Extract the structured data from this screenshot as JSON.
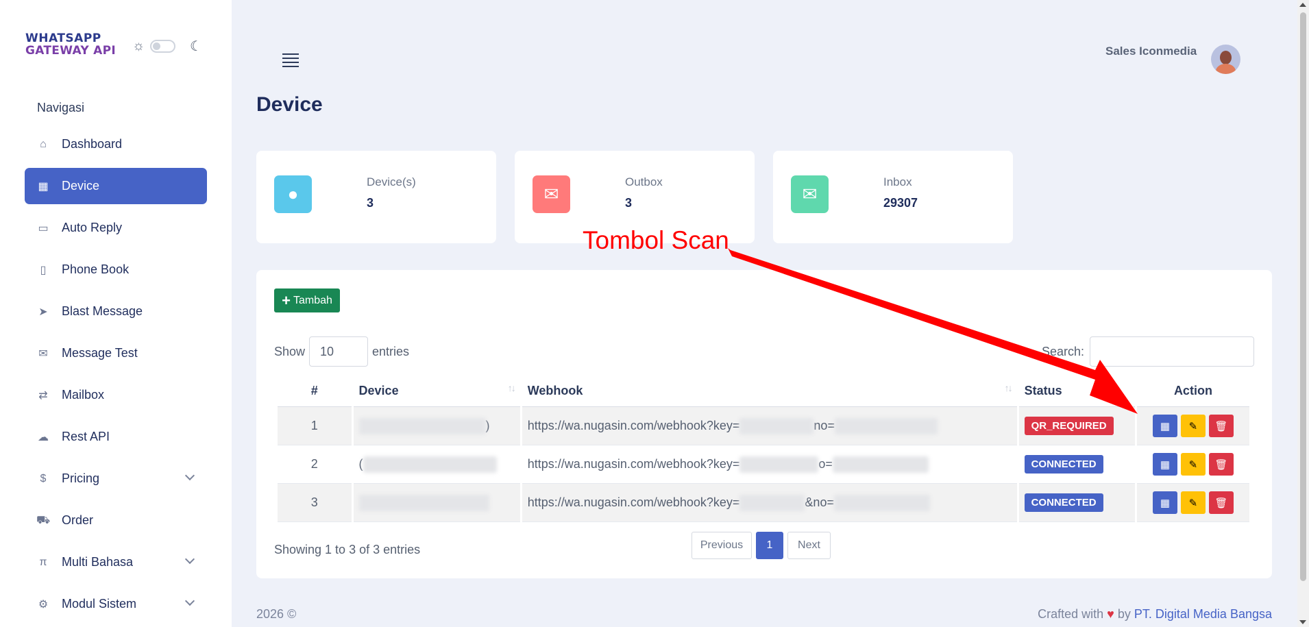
{
  "brand": {
    "line1": "WHATSAPP",
    "line2": "GATEWAY API"
  },
  "sidebar": {
    "heading": "Navigasi",
    "items": [
      {
        "label": "Dashboard",
        "icon": "home-icon",
        "active": false
      },
      {
        "label": "Device",
        "icon": "qr-icon",
        "active": true
      },
      {
        "label": "Auto Reply",
        "icon": "chat-icon",
        "active": false
      },
      {
        "label": "Phone Book",
        "icon": "book-icon",
        "active": false
      },
      {
        "label": "Blast Message",
        "icon": "send-icon",
        "active": false
      },
      {
        "label": "Message Test",
        "icon": "mail-icon",
        "active": false
      },
      {
        "label": "Mailbox",
        "icon": "swap-icon",
        "active": false
      },
      {
        "label": "Rest API",
        "icon": "cloud-icon",
        "active": false
      },
      {
        "label": "Pricing",
        "icon": "money-bag-icon",
        "active": false
      },
      {
        "label": "Order",
        "icon": "cart-icon",
        "active": false
      },
      {
        "label": "Multi Bahasa",
        "icon": "language-icon",
        "active": false
      },
      {
        "label": "Modul Sistem",
        "icon": "gear-icon",
        "active": false
      }
    ]
  },
  "header": {
    "user_name": "Sales Iconmedia"
  },
  "page": {
    "title": "Device"
  },
  "stats": [
    {
      "label": "Device(s)",
      "value": "3",
      "color": "#5ac8eb"
    },
    {
      "label": "Outbox",
      "value": "3",
      "color": "#ff7a7a"
    },
    {
      "label": "Inbox",
      "value": "29307",
      "color": "#5fd8ad"
    }
  ],
  "table_controls": {
    "add_label": "Tambah",
    "show_label": "Show",
    "entries_value": "10",
    "entries_label": "entries",
    "search_label": "Search:"
  },
  "table": {
    "headers": [
      "#",
      "Device",
      "Webhook",
      "Status",
      "Action"
    ],
    "rows": [
      {
        "num": "1",
        "device_suffix": ")",
        "webhook_a": "https://wa.nugasin.com/webhook?key=",
        "webhook_b": "no=",
        "status": "QR_REQUIRED",
        "status_color": "#dc3545"
      },
      {
        "num": "2",
        "device_suffix": "(",
        "webhook_a": "https://wa.nugasin.com/webhook?key=",
        "webhook_b": "o=",
        "status": "CONNECTED",
        "status_color": "#4663c6"
      },
      {
        "num": "3",
        "device_suffix": "",
        "webhook_a": "https://wa.nugasin.com/webhook?key=",
        "webhook_b": "&no=",
        "status": "CONNECTED",
        "status_color": "#4663c6"
      }
    ]
  },
  "pagination": {
    "showing": "Showing 1 to 3 of 3 entries",
    "previous": "Previous",
    "current": "1",
    "next": "Next"
  },
  "footer": {
    "left": "2026 ©",
    "crafted": "Crafted with",
    "by": "by",
    "company": "PT. Digital Media Bangsa"
  },
  "annotation": {
    "text": "Tombol Scan",
    "color": "#ff0000"
  }
}
